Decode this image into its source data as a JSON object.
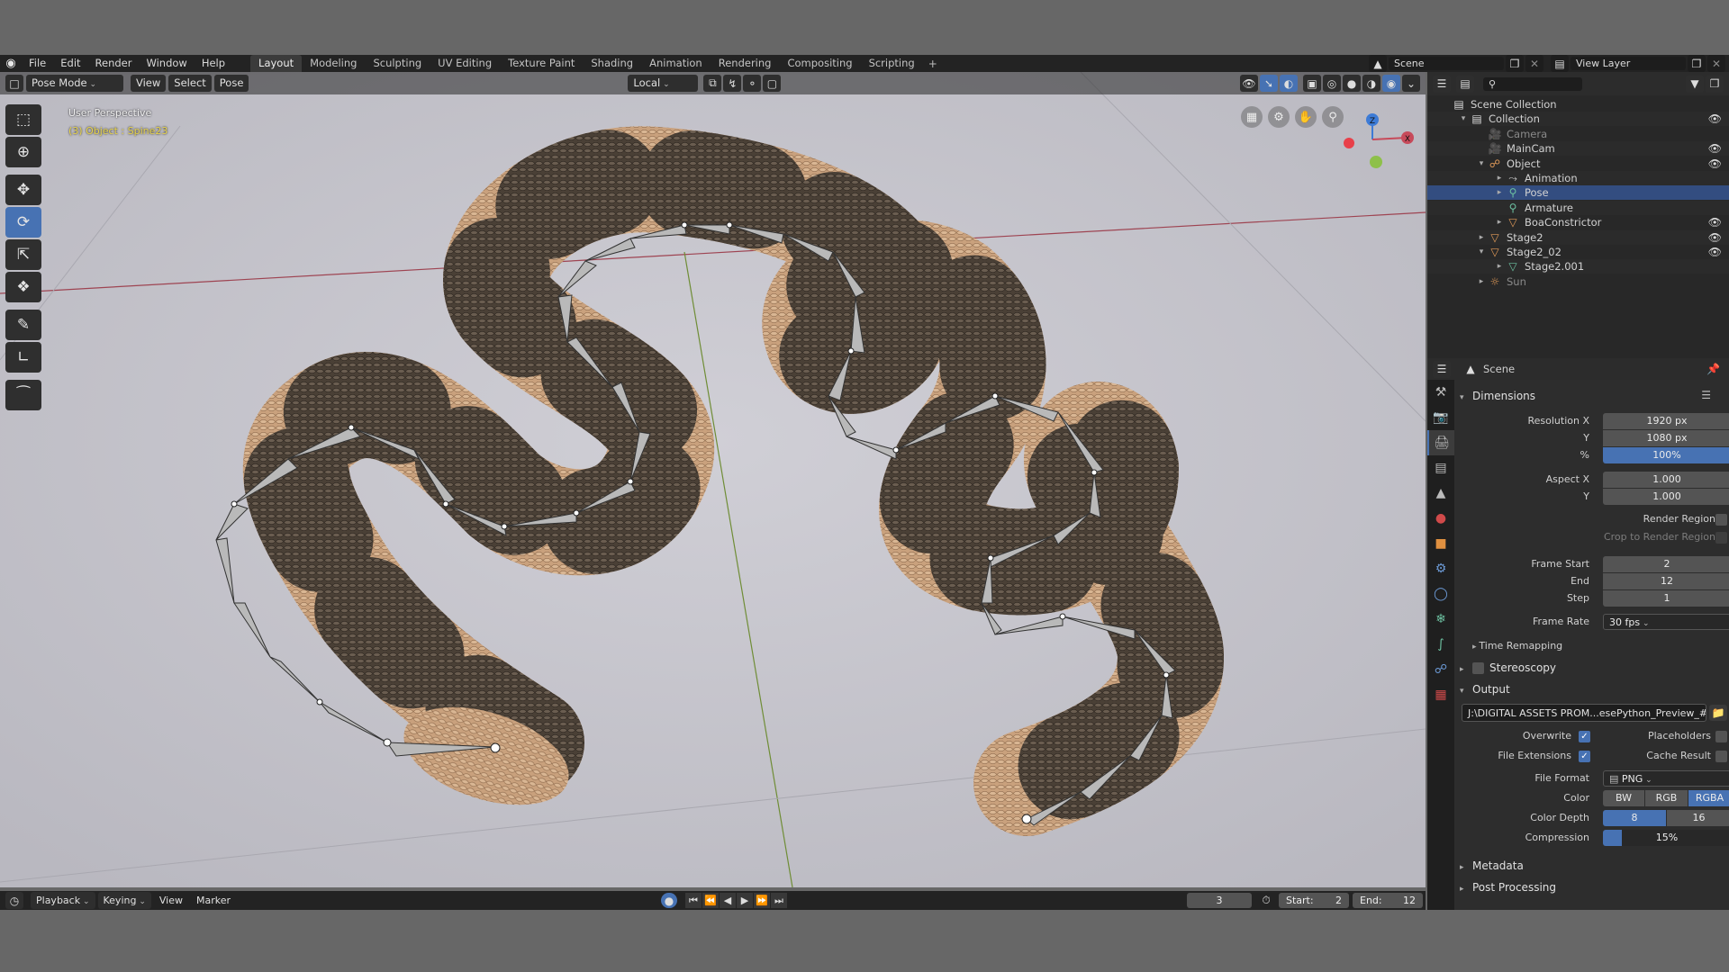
{
  "topbar": {
    "menus": [
      "File",
      "Edit",
      "Render",
      "Window",
      "Help"
    ],
    "workspaces": [
      "Layout",
      "Modeling",
      "Sculpting",
      "UV Editing",
      "Texture Paint",
      "Shading",
      "Animation",
      "Rendering",
      "Compositing",
      "Scripting"
    ],
    "active_workspace": "Layout",
    "add_workspace": "+",
    "scene": "Scene",
    "view_layer": "View Layer"
  },
  "viewport": {
    "mode": "Pose Mode",
    "menus": [
      "View",
      "Select",
      "Pose"
    ],
    "orientation": "Local",
    "overlay_title": "User Perspective",
    "overlay_object": "(3) Object : Spine23",
    "gizmo": {
      "z": "Z",
      "x": "X"
    }
  },
  "outliner": {
    "rows": [
      {
        "label": "Scene Collection",
        "icon": "collection-icon",
        "depth": 0,
        "twisty": "",
        "eye": false
      },
      {
        "label": "Collection",
        "icon": "collection-icon",
        "depth": 1,
        "twisty": "▾",
        "eye": true
      },
      {
        "label": "Camera",
        "icon": "camera-icon",
        "depth": 2,
        "twisty": "",
        "eye": false,
        "dim": true
      },
      {
        "label": "MainCam",
        "icon": "camera-icon",
        "depth": 2,
        "twisty": "",
        "eye": true
      },
      {
        "label": "Object",
        "icon": "armature-icon",
        "depth": 2,
        "twisty": "▾",
        "eye": true
      },
      {
        "label": "Animation",
        "icon": "action-icon",
        "depth": 3,
        "twisty": "▸",
        "eye": false
      },
      {
        "label": "Pose",
        "icon": "pose-icon",
        "depth": 3,
        "twisty": "▸",
        "eye": false,
        "selected": true
      },
      {
        "label": "Armature",
        "icon": "armature-data-icon",
        "depth": 3,
        "twisty": "",
        "eye": false
      },
      {
        "label": "BoaConstrictor",
        "icon": "mesh-icon",
        "depth": 3,
        "twisty": "▸",
        "eye": true
      },
      {
        "label": "Stage2",
        "icon": "mesh-icon",
        "depth": 2,
        "twisty": "▸",
        "eye": true
      },
      {
        "label": "Stage2_02",
        "icon": "mesh-icon",
        "depth": 2,
        "twisty": "▾",
        "eye": true
      },
      {
        "label": "Stage2.001",
        "icon": "mesh-data-icon",
        "depth": 3,
        "twisty": "▸",
        "eye": false
      },
      {
        "label": "Sun",
        "icon": "light-icon",
        "depth": 2,
        "twisty": "▸",
        "eye": false,
        "dim": true
      }
    ]
  },
  "properties": {
    "context": "Scene",
    "dimensions": {
      "title": "Dimensions",
      "res_x_label": "Resolution X",
      "res_x": "1920 px",
      "res_y_label": "Y",
      "res_y": "1080 px",
      "pct_label": "%",
      "pct": "100%",
      "aspect_x_label": "Aspect X",
      "aspect_x": "1.000",
      "aspect_y_label": "Y",
      "aspect_y": "1.000",
      "render_region": "Render Region",
      "crop": "Crop to Render Region",
      "frame_start_label": "Frame Start",
      "frame_start": "2",
      "end_label": "End",
      "end": "12",
      "step_label": "Step",
      "step": "1",
      "frame_rate_label": "Frame Rate",
      "frame_rate": "30 fps",
      "time_remapping": "Time Remapping"
    },
    "stereoscopy": "Stereoscopy",
    "output": {
      "title": "Output",
      "path": "J:\\DIGITAL ASSETS PROM...esePython_Preview_##",
      "overwrite": "Overwrite",
      "placeholders": "Placeholders",
      "file_extensions": "File Extensions",
      "cache_result": "Cache Result",
      "file_format_label": "File Format",
      "file_format": "PNG",
      "color_label": "Color",
      "color_options": [
        "BW",
        "RGB",
        "RGBA"
      ],
      "color_selected": "RGBA",
      "depth_label": "Color Depth",
      "depth_options": [
        "8",
        "16"
      ],
      "depth_selected": "8",
      "compression_label": "Compression",
      "compression": "15%",
      "compression_value": 0.15
    },
    "metadata": "Metadata",
    "post_processing": "Post Processing"
  },
  "timeline": {
    "menus": [
      "Playback",
      "Keying",
      "View",
      "Marker"
    ],
    "current_frame": "3",
    "start_label": "Start:",
    "start": "2",
    "end_label": "End:",
    "end": "12"
  }
}
